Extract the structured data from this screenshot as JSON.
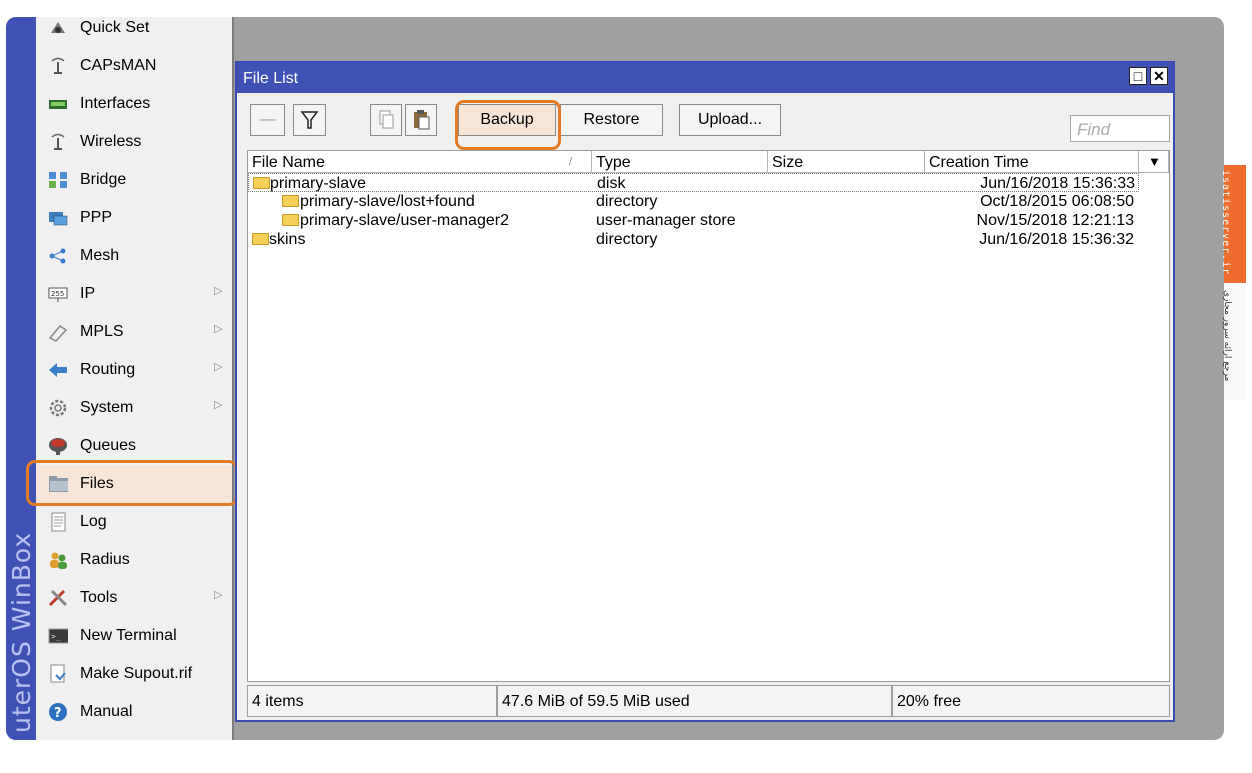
{
  "sidebar": {
    "brand": "uterOS WinBox",
    "items": [
      {
        "label": "Quick Set",
        "icon": "quick-set-icon",
        "submenu": false
      },
      {
        "label": "CAPsMAN",
        "icon": "antenna-icon",
        "submenu": false
      },
      {
        "label": "Interfaces",
        "icon": "interfaces-icon",
        "submenu": false
      },
      {
        "label": "Wireless",
        "icon": "wireless-icon",
        "submenu": false
      },
      {
        "label": "Bridge",
        "icon": "bridge-icon",
        "submenu": false
      },
      {
        "label": "PPP",
        "icon": "ppp-icon",
        "submenu": false
      },
      {
        "label": "Mesh",
        "icon": "mesh-icon",
        "submenu": false
      },
      {
        "label": "IP",
        "icon": "ip-icon",
        "submenu": true
      },
      {
        "label": "MPLS",
        "icon": "mpls-icon",
        "submenu": true
      },
      {
        "label": "Routing",
        "icon": "routing-icon",
        "submenu": true
      },
      {
        "label": "System",
        "icon": "gear-icon",
        "submenu": true
      },
      {
        "label": "Queues",
        "icon": "queues-icon",
        "submenu": false
      },
      {
        "label": "Files",
        "icon": "folder-icon",
        "submenu": false,
        "selected": true
      },
      {
        "label": "Log",
        "icon": "log-icon",
        "submenu": false
      },
      {
        "label": "Radius",
        "icon": "users-icon",
        "submenu": false
      },
      {
        "label": "Tools",
        "icon": "tools-icon",
        "submenu": true
      },
      {
        "label": "New Terminal",
        "icon": "terminal-icon",
        "submenu": false
      },
      {
        "label": "Make Supout.rif",
        "icon": "document-icon",
        "submenu": false
      },
      {
        "label": "Manual",
        "icon": "help-icon",
        "submenu": false
      }
    ]
  },
  "window": {
    "title": "File List",
    "maximize_glyph": "□",
    "close_glyph": "✕"
  },
  "toolbar": {
    "remove_glyph": "—",
    "filter_glyph": "▽",
    "backup_label": "Backup",
    "restore_label": "Restore",
    "upload_label": "Upload...",
    "find_placeholder": "Find"
  },
  "table": {
    "columns": [
      "File Name",
      "Type",
      "Size",
      "Creation Time"
    ],
    "sort_glyph": "/",
    "dropdown_glyph": "▼",
    "rows": [
      {
        "name": "primary-slave",
        "type": "disk",
        "size": "",
        "created": "Jun/16/2018 15:36:33",
        "indent": 0
      },
      {
        "name": "primary-slave/lost+found",
        "type": "directory",
        "size": "",
        "created": "Oct/18/2015 06:08:50",
        "indent": 1
      },
      {
        "name": "primary-slave/user-manager2",
        "type": "user-manager store",
        "size": "",
        "created": "Nov/15/2018 12:21:13",
        "indent": 1
      },
      {
        "name": "skins",
        "type": "directory",
        "size": "",
        "created": "Jun/16/2018 15:36:32",
        "indent": 0
      }
    ]
  },
  "status": {
    "items": "4 items",
    "usage": "47.6 MiB of 59.5 MiB used",
    "free": "20% free"
  },
  "watermark": {
    "site": "isatisserver.ir",
    "caption": "مرجع ارائه سرور مجازی"
  },
  "colors": {
    "title_bar": "#3f51b5",
    "highlight": "#e57a24",
    "folder": "#f6cf57"
  }
}
